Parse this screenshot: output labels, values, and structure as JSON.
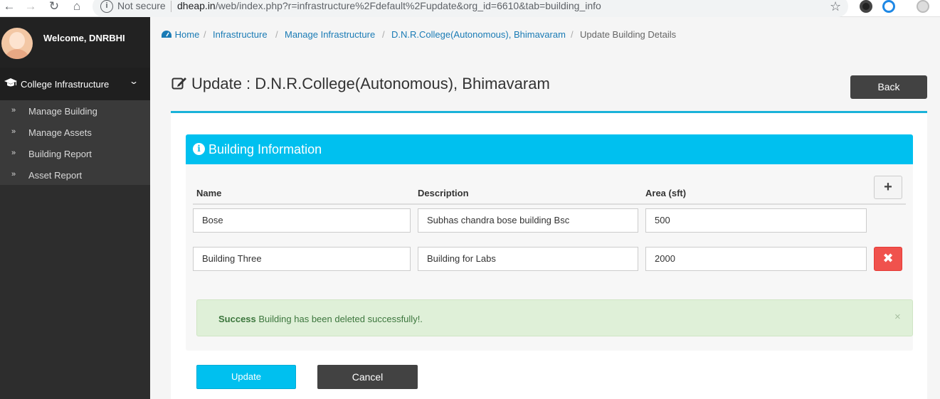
{
  "browser": {
    "security_label": "Not secure",
    "url_domain": "dheap.in",
    "url_path": "/web/index.php?r=infrastructure%2Fdefault%2Fupdate&org_id=6610&tab=building_info"
  },
  "sidebar": {
    "welcome": "Welcome, DNRBHI",
    "menu_title": "College Infrastructure",
    "items": [
      {
        "label": "Manage Building"
      },
      {
        "label": "Manage Assets"
      },
      {
        "label": "Building Report"
      },
      {
        "label": "Asset Report"
      }
    ]
  },
  "breadcrumb": {
    "home": "Home",
    "infrastructure": "Infrastructure",
    "manage": "Manage Infrastructure",
    "college": "D.N.R.College(Autonomous), Bhimavaram",
    "current": "Update Building Details",
    "separator": "/"
  },
  "page": {
    "title": "Update : D.N.R.College(Autonomous), Bhimavaram",
    "back_label": "Back"
  },
  "panel": {
    "title": "Building Information",
    "columns": {
      "name": "Name",
      "description": "Description",
      "area": "Area (sft)"
    },
    "add_label": "+",
    "rows": [
      {
        "name": "Bose",
        "description": "Subhas chandra bose building Bsc",
        "area": "500"
      },
      {
        "name": "Building Three",
        "description": "Building for Labs",
        "area": "2000"
      }
    ],
    "delete_label": "✖"
  },
  "alert": {
    "strong": "Success",
    "message": " Building has been deleted successfully!.",
    "close": "×"
  },
  "actions": {
    "update_label": "Update",
    "cancel_label": "Cancel"
  },
  "colors": {
    "accent": "#00c0ef",
    "sidebar_bg": "#2d2d2d",
    "danger": "#f0524d",
    "success_bg": "#dff0d8"
  }
}
